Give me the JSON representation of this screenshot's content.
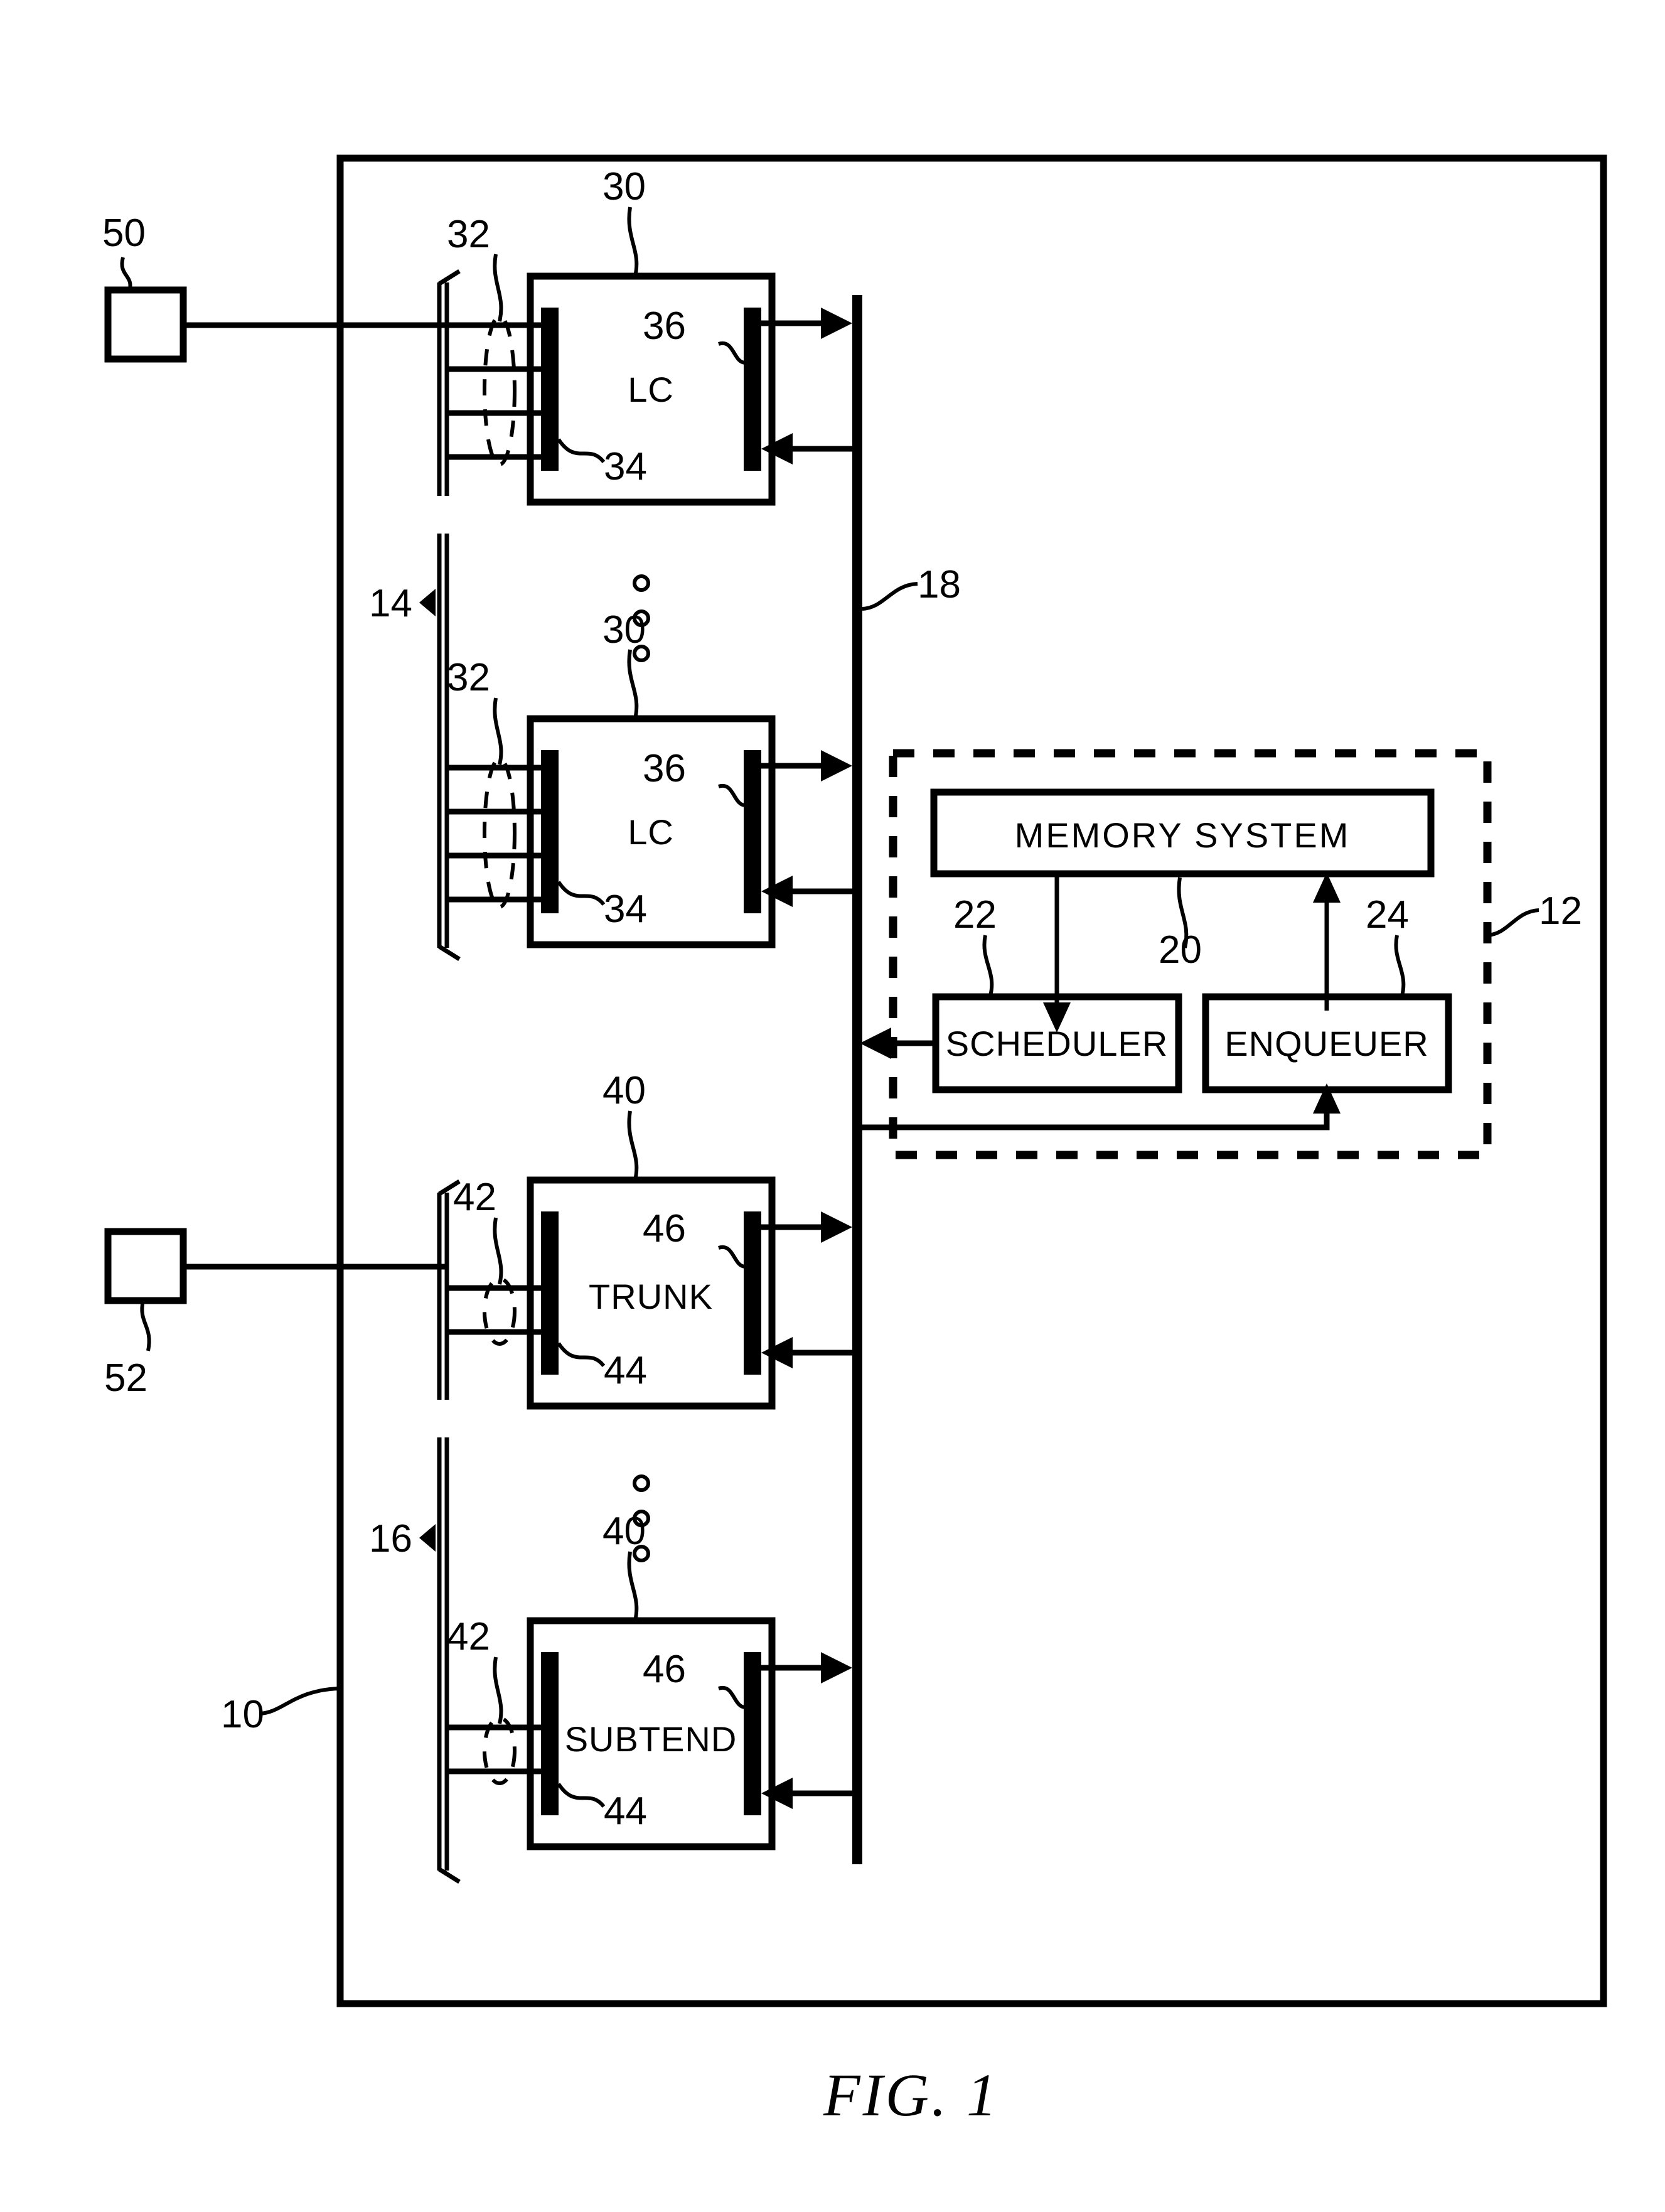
{
  "figure": {
    "caption": "FIG.  1",
    "title_context": "Patent line drawing of a switching node block diagram"
  },
  "reference_numerals": {
    "outer_chassis": "10",
    "switch_fabric_core": "12",
    "line_card_group": "14",
    "trunk_group": "16",
    "bus": "18",
    "memory_system": "20",
    "scheduler": "22",
    "enqueuer": "24",
    "line_card_top": "30",
    "line_card_top_ports": "32",
    "line_card_top_ingress": "34",
    "line_card_top_egress": "36",
    "line_card_bottom": "30",
    "line_card_bottom_ports": "32",
    "line_card_bottom_ingress": "34",
    "line_card_bottom_egress": "36",
    "trunk_card": "40",
    "trunk_ports": "42",
    "trunk_ingress": "44",
    "trunk_egress": "46",
    "subtend_card": "40",
    "subtend_ports": "42",
    "subtend_ingress": "44",
    "subtend_egress": "46",
    "external_node_top": "50",
    "external_node_bottom": "52"
  },
  "blocks": {
    "line_card_top": {
      "label": "LC"
    },
    "line_card_bottom": {
      "label": "LC"
    },
    "trunk_card": {
      "label": "TRUNK"
    },
    "subtend_card": {
      "label": "SUBTEND"
    },
    "memory_system": {
      "label": "MEMORY  SYSTEM"
    },
    "scheduler": {
      "label": "SCHEDULER"
    },
    "enqueuer": {
      "label": "ENQUEUER"
    }
  },
  "colors": {
    "ink": "#000000",
    "paper": "#ffffff"
  }
}
